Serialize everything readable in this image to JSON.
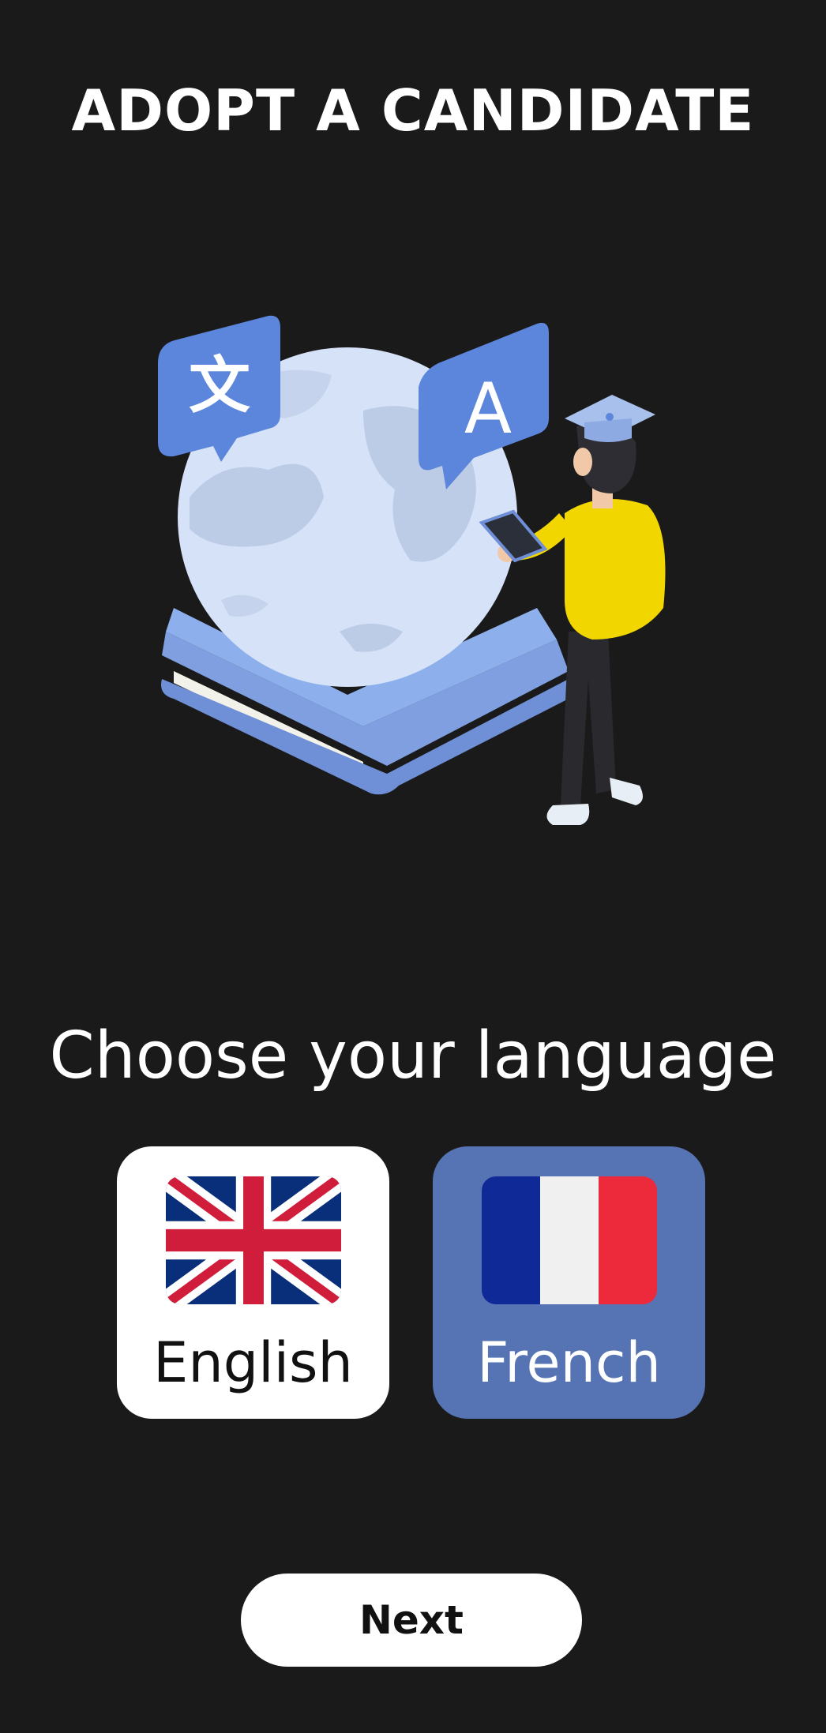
{
  "header": {
    "title": "ADOPT A CANDIDATE"
  },
  "hero": {
    "illustration": "language-learning-globe-illustration",
    "bubble_left_glyph": "文",
    "bubble_right_glyph": "A"
  },
  "language_picker": {
    "prompt": "Choose your language",
    "options": [
      {
        "label": "English",
        "icon": "uk-flag-icon",
        "selected": false
      },
      {
        "label": "French",
        "icon": "france-flag-icon",
        "selected": true
      }
    ]
  },
  "footer": {
    "next_label": "Next"
  },
  "colors": {
    "background": "#1a1a1a",
    "accent": "#5674b4",
    "card_white": "#ffffff"
  }
}
